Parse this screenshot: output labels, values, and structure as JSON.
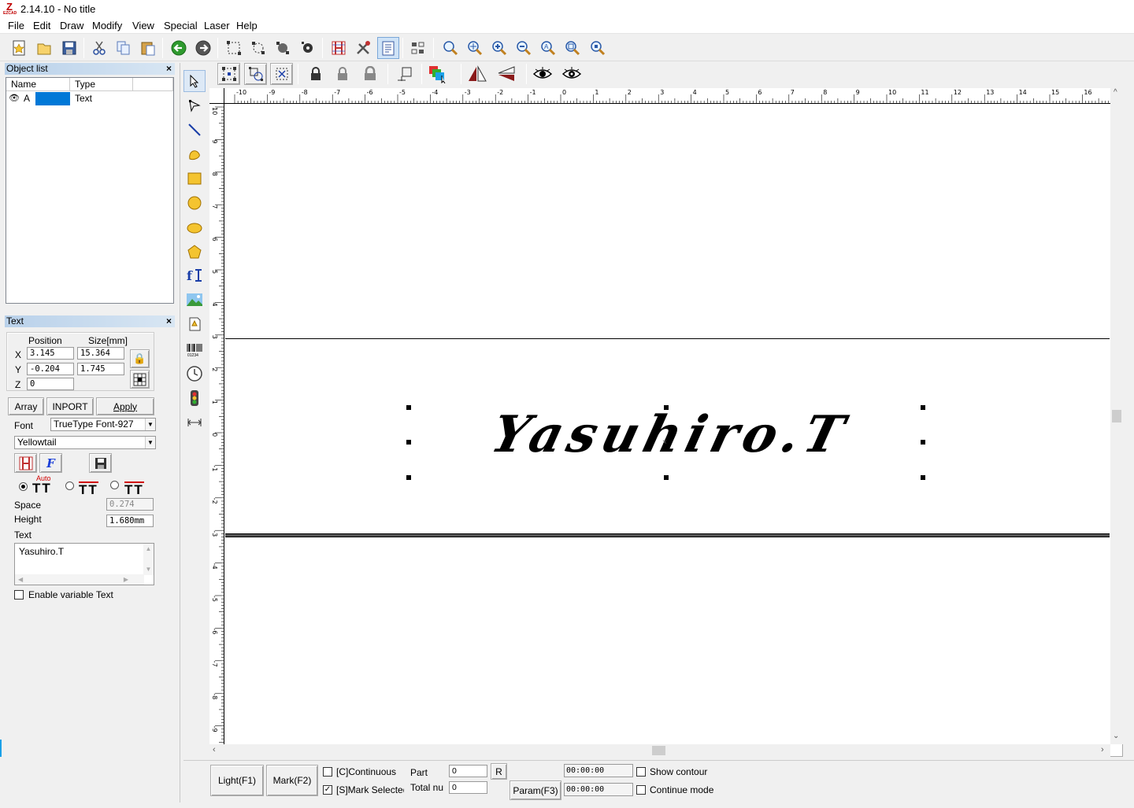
{
  "window": {
    "title": "2.14.10 - No title",
    "logo": "Z",
    "logo_sub": "EZCAD"
  },
  "menu": [
    "File",
    "Edit",
    "Draw",
    "Modify",
    "View",
    "Special",
    "Laser",
    "Help"
  ],
  "object_list": {
    "title": "Object list",
    "columns": [
      "Name",
      "Type"
    ],
    "rows": [
      {
        "name": "A",
        "type": "Text"
      }
    ]
  },
  "text_panel": {
    "title": "Text",
    "position_label": "Position",
    "size_label": "Size[mm]",
    "x_label": "X",
    "y_label": "Y",
    "z_label": "Z",
    "x": "3.145",
    "y": "-0.204",
    "z": "0",
    "size_x": "15.364",
    "size_y": "1.745",
    "array_label": "Array",
    "import_label": "INPORT",
    "apply_label": "Apply",
    "font_label": "Font",
    "font_type": "TrueType Font-927",
    "font_name": "Yellowtail",
    "auto_label": "Auto",
    "space_label": "Space",
    "space_value": "0.274",
    "height_label": "Height",
    "height_value": "1.680mm",
    "text_label": "Text",
    "text_value": "Yasuhiro.T",
    "variable_label": "Enable variable Text"
  },
  "canvas": {
    "ruler_x": [
      "-10",
      "-9",
      "-8",
      "-7",
      "-6",
      "-5",
      "-4",
      "-3",
      "-2",
      "-1",
      "0",
      "1",
      "2",
      "3",
      "4",
      "5",
      "6",
      "7",
      "8",
      "9",
      "10",
      "11",
      "12",
      "13",
      "14",
      "15",
      "16"
    ],
    "ruler_y": [
      "10",
      "9",
      "8",
      "7",
      "6",
      "5",
      "4",
      "3",
      "2",
      "1",
      "0",
      "-1",
      "-2",
      "-3",
      "-4",
      "-5",
      "-6",
      "-7",
      "-8",
      "-9"
    ],
    "text": "Yasuhiro.T"
  },
  "bottom": {
    "light": "Light(F1)",
    "mark": "Mark(F2)",
    "continuous": "[C]Continuous",
    "mark_selected": "[S]Mark Selected",
    "part_label": "Part",
    "part_value": "0",
    "total_label": "Total nu",
    "total_value": "0",
    "r_label": "R",
    "param": "Param(F3)",
    "time1": "00:00:00",
    "time2": "00:00:00",
    "show_contour": "Show contour",
    "continue_mode": "Continue mode"
  },
  "colors": {
    "selection": "#0078d7",
    "panel_title": "#b9d1ea"
  }
}
